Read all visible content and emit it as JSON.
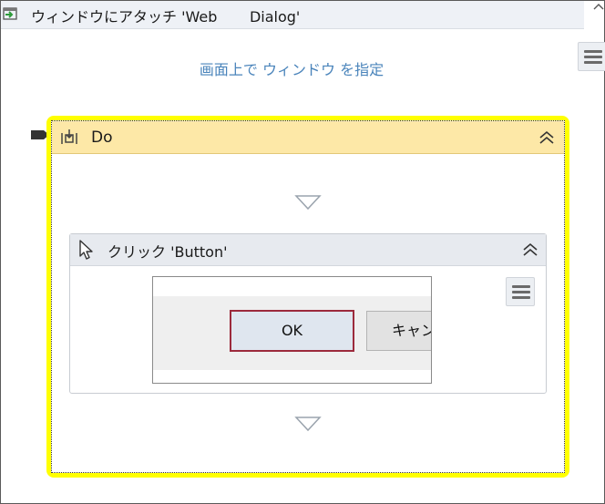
{
  "attach_window": {
    "title": "ウィンドウにアタッチ 'Web       Dialog'",
    "indicate_link": "画面上で ウィンドウ を指定",
    "icon": "attach-window-icon",
    "collapse_icon": "collapse-corner-icon"
  },
  "do_sequence": {
    "title": "Do",
    "icon": "sequence-icon",
    "collapse_icon": "double-chevron-up-icon",
    "outline_color": "#ffff00",
    "header_color": "#fde8a7"
  },
  "click_activity": {
    "title": "クリック 'Button'",
    "icon": "mouse-pointer-icon",
    "collapse_icon": "double-chevron-up-icon",
    "preview": {
      "ok_label": "OK",
      "cancel_label": "キャンセル",
      "highlight_color": "#9c2a3c"
    }
  },
  "colors": {
    "link": "#4a84bb",
    "header_bg": "#eef1f6"
  }
}
